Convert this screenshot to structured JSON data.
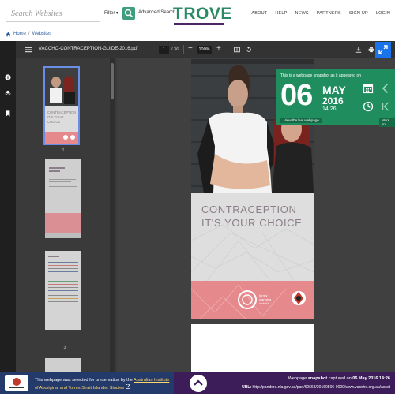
{
  "header": {
    "search_placeholder": "Search Websites",
    "filter_label": "Filter",
    "advanced_search_label": "Advanced Search",
    "logo_text": "TROVE",
    "nav": [
      "ABOUT",
      "HELP",
      "NEWS",
      "PARTNERS",
      "SIGN UP",
      "LOGIN"
    ]
  },
  "breadcrumb": {
    "home": "Home",
    "separator": "/",
    "current": "Websites"
  },
  "viewer": {
    "doc_title": "VACCHO-CONTRACEPTION-GUIDE-2016.pdf",
    "current_page": "1",
    "page_total": "/ 36",
    "zoom": "100%",
    "thumbnails": [
      {
        "number": "1",
        "selected": true
      },
      {
        "number": "2",
        "selected": false
      },
      {
        "number": "3",
        "selected": false
      }
    ],
    "cover": {
      "title": "CONTRACEPTION",
      "subtitle": "IT'S YOUR CHOICE"
    }
  },
  "snapshot": {
    "caption": "This is a webpage snapshot as it appeared on",
    "day": "06",
    "month": "MAY",
    "year": "2016",
    "time": "14:26",
    "view_live_label": "View the live webpage",
    "more_label": "More sn"
  },
  "footer": {
    "preservation_prefix": "This webpage was selected for preservation by the ",
    "institute_link": "Australian Institute of Aboriginal and Torres Strait Islander Studies",
    "snapshot_label": "Webpage ",
    "snapshot_bold": "snapshot",
    "snapshot_mid": " captured on ",
    "snapshot_date": "06 May 2016 14:26",
    "url_label": "URL:",
    "url": "http://pandora.nla.gov.au/pan/60663/20160506-0000/www.vaccho.org.au/asset"
  },
  "colors": {
    "accent_green": "#3f9e7d",
    "snapshot_green": "#1f8d5d",
    "footer_blue": "#243a6b",
    "footer_purple": "#3c1d59",
    "expand_blue": "#1a73e8"
  }
}
